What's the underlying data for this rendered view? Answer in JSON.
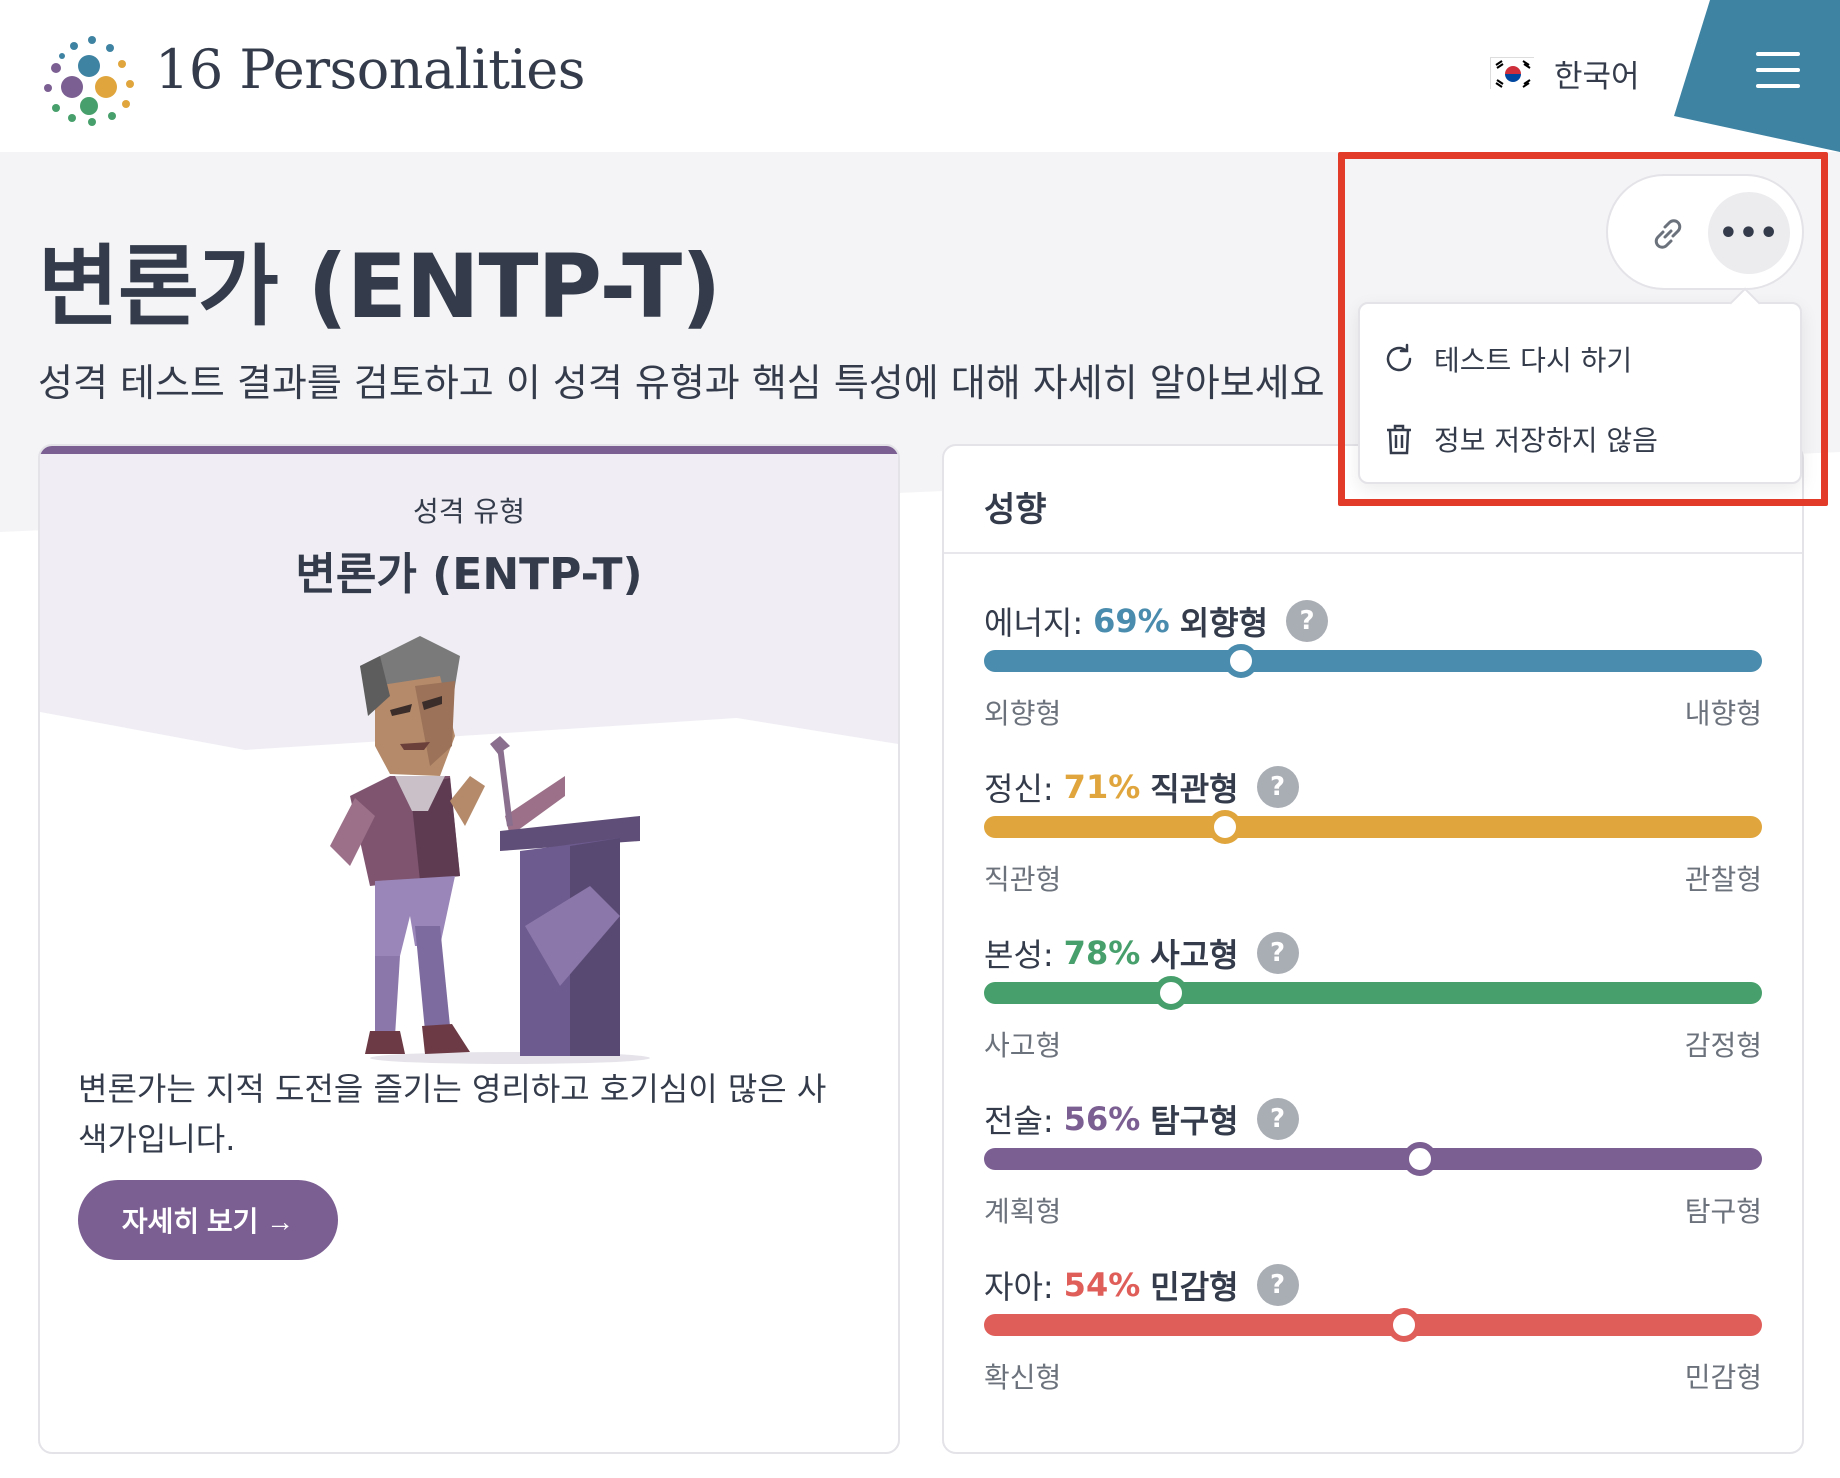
{
  "header": {
    "brand": "16 Personalities",
    "language": "한국어",
    "icons": {
      "logo": "dots-logo-icon",
      "flag": "korea-flag-icon",
      "menu": "hamburger-menu-icon"
    }
  },
  "hero": {
    "title": "변론가 (ENTP-T)",
    "subtitle": "성격 테스트 결과를 검토하고 이 성격 유형과 핵심 특성에 대해 자세히 알아보세요"
  },
  "actions": {
    "link_icon": "link-icon",
    "more_label": "•••",
    "menu": [
      {
        "label": "테스트 다시 하기",
        "icon": "refresh-icon"
      },
      {
        "label": "정보 저장하지 않음",
        "icon": "trash-icon"
      }
    ]
  },
  "type_card": {
    "label": "성격 유형",
    "name": "변론가 (ENTP-T)",
    "description": "변론가는 지적 도전을 즐기는 영리하고 호기심이 많은 사색가입니다.",
    "button": "자세히 보기 →",
    "illustration": "debater-at-podium-illustration"
  },
  "traits": {
    "title": "성향",
    "help_label": "?",
    "items": [
      {
        "category": "에너지:",
        "percent": "69%",
        "name": "외향형",
        "left": "외향형",
        "right": "내향형",
        "color": "#4a8cad",
        "position": 0.33
      },
      {
        "category": "정신:",
        "percent": "71%",
        "name": "직관형",
        "left": "직관형",
        "right": "관찰형",
        "color": "#e0a63d",
        "position": 0.31
      },
      {
        "category": "본성:",
        "percent": "78%",
        "name": "사고형",
        "left": "사고형",
        "right": "감정형",
        "color": "#47a06b",
        "position": 0.24
      },
      {
        "category": "전술:",
        "percent": "56%",
        "name": "탐구형",
        "left": "계획형",
        "right": "탐구형",
        "color": "#7b5e92",
        "position": 0.56
      },
      {
        "category": "자아:",
        "percent": "54%",
        "name": "민감형",
        "left": "확신형",
        "right": "민감형",
        "color": "#e05e5a",
        "position": 0.54
      }
    ]
  },
  "colors": {
    "brand_purple": "#7b5e92",
    "menu_teal": "#3f83a3",
    "annotation_red": "#e23b2a"
  }
}
